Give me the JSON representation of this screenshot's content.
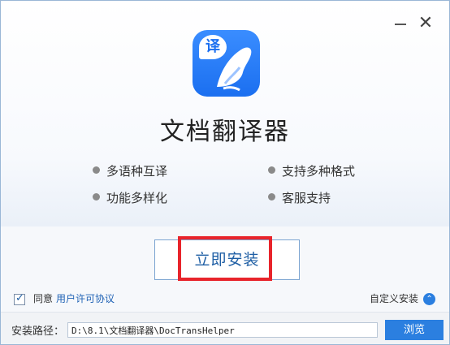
{
  "window": {
    "minimize_icon": "minimize-icon",
    "close_glyph": "✕"
  },
  "app": {
    "logo_badge": "译",
    "title": "文档翻译器"
  },
  "features": [
    "多语种互译",
    "支持多种格式",
    "功能多样化",
    "客服支持"
  ],
  "install": {
    "button_label": "立即安装"
  },
  "agreement": {
    "prefix": "同意",
    "link": "用户许可协议",
    "checked": true
  },
  "custom_install": {
    "label": "自定义安装"
  },
  "path": {
    "label": "安装路径：",
    "value": "D:\\8.1\\文档翻译器\\DocTransHelper",
    "browse_label": "浏览"
  },
  "colors": {
    "accent": "#2b7fe0",
    "highlight": "#e8242b",
    "link": "#1f62b5"
  }
}
